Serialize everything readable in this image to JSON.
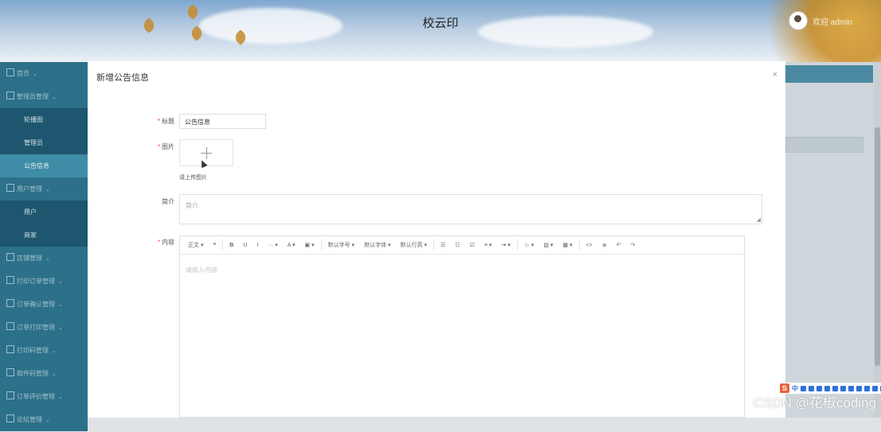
{
  "header": {
    "app_title": "校云印",
    "user_name": "欢迎 admin"
  },
  "sidebar": {
    "items": [
      {
        "label": "首页",
        "type": "group"
      },
      {
        "label": "管理员管理",
        "type": "group"
      },
      {
        "label": "轮播图",
        "type": "sub"
      },
      {
        "label": "管理员",
        "type": "sub"
      },
      {
        "label": "公告信息",
        "type": "sub",
        "active": true
      },
      {
        "label": "用户管理",
        "type": "group"
      },
      {
        "label": "用户",
        "type": "sub"
      },
      {
        "label": "商家",
        "type": "sub"
      },
      {
        "label": "店铺管理",
        "type": "group"
      },
      {
        "label": "打印订单管理",
        "type": "group"
      },
      {
        "label": "订单确认管理",
        "type": "group"
      },
      {
        "label": "订单打印管理",
        "type": "group"
      },
      {
        "label": "打印码管理",
        "type": "group"
      },
      {
        "label": "取件码管理",
        "type": "group"
      },
      {
        "label": "订单评价管理",
        "type": "group"
      },
      {
        "label": "论坛管理",
        "type": "group"
      }
    ]
  },
  "modal": {
    "title": "新增公告信息",
    "close_label": "×",
    "fields": {
      "title_label": "标题",
      "title_value": "公告信息",
      "image_label": "图片",
      "upload_tip": "请上传图片",
      "summary_label": "简介",
      "summary_placeholder": "简介",
      "content_label": "内容",
      "content_placeholder": "请输入内容"
    },
    "toolbar": {
      "items": [
        "正文 ▾",
        "❝",
        "B",
        "U",
        "I",
        "··· ▾",
        "A ▾",
        "▣ ▾",
        "默认字号 ▾",
        "默认字体 ▾",
        "默认行高 ▾",
        "☰",
        "☷",
        "☑",
        "≡ ▾",
        "⇥ ▾",
        "☺ ▾",
        "▨ ▾",
        "▦ ▾",
        "<>",
        "≣",
        "↶",
        "↷"
      ]
    }
  },
  "watermark": "CSDN @花椒coding",
  "ime": {
    "logo": "S",
    "text": "中"
  }
}
